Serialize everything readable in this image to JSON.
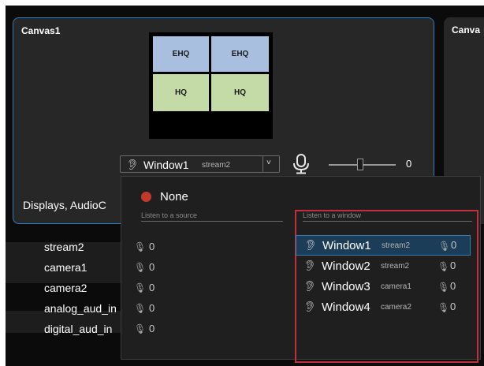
{
  "canvases": [
    {
      "title": "Canvas1"
    },
    {
      "title": "Canva"
    }
  ],
  "preview": {
    "cells": [
      "EHQ",
      "EHQ",
      "HQ",
      "HQ"
    ],
    "colors": {
      "ehq": "#a9bfdf",
      "hq": "#c4dba8"
    }
  },
  "audio_select": {
    "icon": "ear-icon",
    "name": "Window1",
    "sub": "stream2",
    "chevron": "˅"
  },
  "volume": {
    "icon": "microphone-icon",
    "value": "0"
  },
  "displays_label": "Displays, AudioC",
  "dropdown": {
    "none_label": "None",
    "source_section": "Listen to a source",
    "window_section": "Listen to a window",
    "sources": [
      {
        "name": "stream2",
        "vol": "0"
      },
      {
        "name": "camera1",
        "vol": "0"
      },
      {
        "name": "camera2",
        "vol": "0"
      },
      {
        "name": "analog_aud_in",
        "vol": "0"
      },
      {
        "name": "digital_aud_in",
        "vol": "0"
      }
    ],
    "windows": [
      {
        "name": "Window1",
        "sub": "stream2",
        "vol": "0",
        "selected": true
      },
      {
        "name": "Window2",
        "sub": "stream2",
        "vol": "0",
        "selected": false
      },
      {
        "name": "Window3",
        "sub": "camera1",
        "vol": "0",
        "selected": false
      },
      {
        "name": "Window4",
        "sub": "camera2",
        "vol": "0",
        "selected": false
      }
    ]
  },
  "colors": {
    "accent": "#2f7ac0",
    "highlight": "#c0303a",
    "background": "#0b0b0b"
  }
}
